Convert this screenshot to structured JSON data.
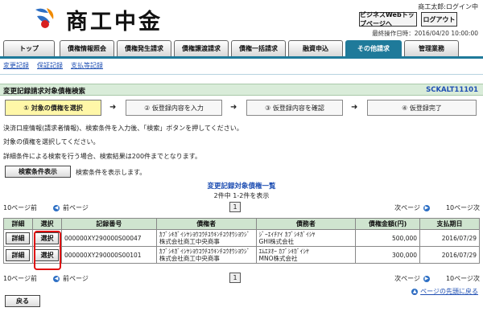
{
  "header": {
    "brand": "商工中金",
    "user": "商工太郎:ログイン中",
    "top_button": "ビジネスWebトップページへ",
    "logout_button": "ログアウト",
    "last_operation": "最終操作日時：2016/04/20 10:00:00",
    "brand_colors": {
      "blue": "#2d6fc4",
      "orange": "#f08a00",
      "red": "#d82020"
    }
  },
  "tabs": [
    {
      "label": "トップ"
    },
    {
      "label": "債権情報照会"
    },
    {
      "label": "債権発生請求"
    },
    {
      "label": "債権譲渡請求"
    },
    {
      "label": "債権一括請求"
    },
    {
      "label": "融資申込"
    },
    {
      "label": "その他請求"
    },
    {
      "label": "管理業務"
    }
  ],
  "active_tab": "その他請求",
  "subnav": [
    "変更記録",
    "保証記録",
    "支払等記録"
  ],
  "page": {
    "title": "変更記録請求対象債権検索",
    "code": "SCKALT11101"
  },
  "steps": [
    {
      "label": "① 対象の債権を選択"
    },
    {
      "label": "② 仮登録内容を入力"
    },
    {
      "label": "③ 仮登録内容を確認"
    },
    {
      "label": "④ 仮登録完了"
    }
  ],
  "step_arrow": "➜",
  "messages": {
    "line1": "決済口座情報(請求者情報)、検索条件を入力後、「検索」ボタンを押してください。",
    "line2": "対象の債権を選択してください。",
    "line3": "詳細条件による検索を行う場合、検索結果は200件までとなります。",
    "search_hint": "検索条件を表示します。"
  },
  "search_toggle_button": "検索条件表示",
  "list": {
    "title": "変更記録対象債権一覧",
    "count": "2件中 1-2件を表示",
    "prev10": "10ページ前",
    "prev": "前ページ",
    "next": "次ページ",
    "next10": "10ページ次",
    "current_page": "1",
    "columns": [
      "詳細",
      "選択",
      "記録番号",
      "債権者",
      "債務者",
      "債権金額(円)",
      "支払期日"
    ],
    "rows": [
      {
        "detail": "詳細",
        "select": "選択",
        "record_no": "000000XY290000S00047",
        "creditor_kana": "ｶﾌﾞｼｷｶﾞｲｼﾔｼﾖｳｺｳﾁﾕｳｷﾝﾁﾕｳｵｳｼﾖｳｼﾞ",
        "creditor": "株式会社商工中央商事",
        "debtor_kana": "ｼﾞｰｴｲﾁｱｲ ｶﾌﾞｼｷｶﾞｲｼﾔ",
        "debtor": "GHI株式会社",
        "amount": "500,000",
        "due": "2016/07/29"
      },
      {
        "detail": "詳細",
        "select": "選択",
        "record_no": "000000XY290000S00101",
        "creditor_kana": "ｶﾌﾞｼｷｶﾞｲｼﾔｼﾖｳｺｳﾁﾕｳｷﾝﾁﾕｳｵｳｼﾖｳｼﾞ",
        "creditor": "株式会社商工中央商事",
        "debtor_kana": "ｴﾑｴﾇｵｰ ｶﾌﾞｼｷｶﾞｲｼﾔ",
        "debtor": "MNO株式会社",
        "amount": "300,000",
        "due": "2016/07/29"
      }
    ]
  },
  "back_to_top": "ページの先頭に戻る",
  "back_button": "戻る"
}
